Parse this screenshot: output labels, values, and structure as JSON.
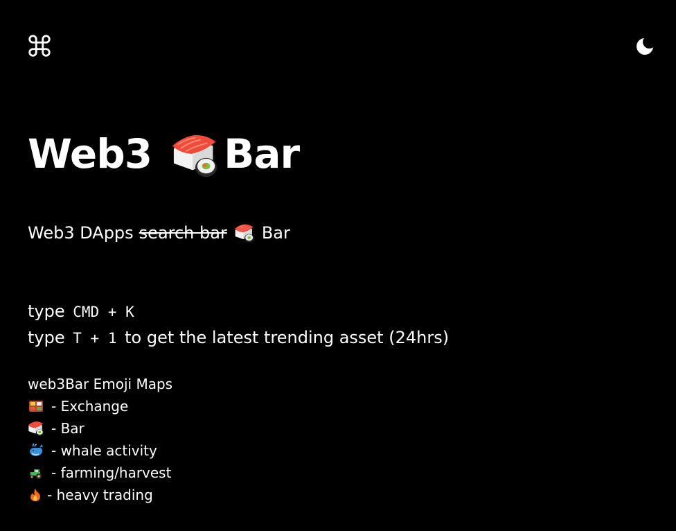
{
  "header": {
    "command_icon": "command-icon",
    "theme_toggle_icon": "moon-icon"
  },
  "hero": {
    "title_left": "Web3",
    "title_emoji": "sushi-icon",
    "title_right": "Bar"
  },
  "subtitle": {
    "prefix": "Web3 DApps",
    "struck": "search bar",
    "emoji": "sushi-icon",
    "suffix": "Bar"
  },
  "shortcuts": {
    "line1_prefix": "type",
    "line1_keys": "CMD + K",
    "line2_prefix": "type",
    "line2_keys": "T + 1",
    "line2_suffix": "to get the latest trending asset (24hrs)"
  },
  "emoji_maps": {
    "heading": "web3Bar Emoji Maps",
    "items": [
      {
        "icon": "bento-box-icon",
        "label": "- Exchange"
      },
      {
        "icon": "sushi-icon",
        "label": "- Bar"
      },
      {
        "icon": "whale-icon",
        "label": "- whale activity"
      },
      {
        "icon": "tractor-icon",
        "label": "- farming/harvest"
      },
      {
        "icon": "fire-icon",
        "label": "- heavy trading"
      }
    ]
  },
  "colors": {
    "background": "#000000",
    "text": "#ffffff"
  }
}
